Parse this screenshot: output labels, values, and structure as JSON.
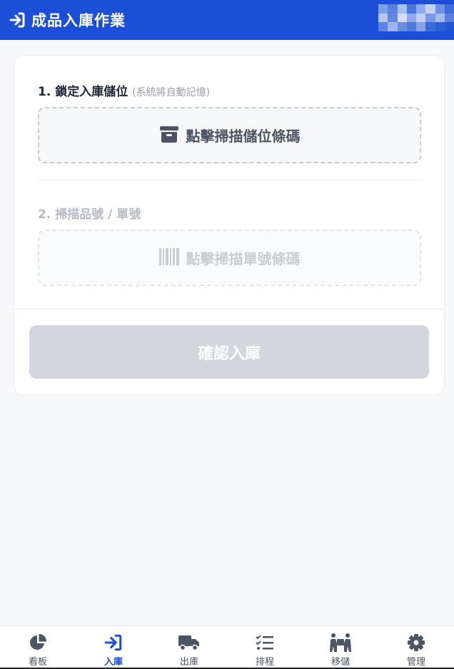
{
  "header": {
    "title": "成品入庫作業",
    "icon": "login-arrow-icon",
    "bg_color": "#1c4ed8"
  },
  "steps": [
    {
      "label": "1. 鎖定入庫儲位",
      "hint": "(系統將自動記憶)",
      "scan_text": "點擊掃描儲位條碼",
      "icon": "box-archive-icon",
      "enabled": true
    },
    {
      "label": "2. 掃描品號 / 單號",
      "scan_text": "點擊掃描單號條碼",
      "icon": "barcode-icon",
      "enabled": false
    }
  ],
  "confirm_label": "確認入庫",
  "tabs": [
    {
      "label": "看板",
      "icon": "chart-pie-icon",
      "active": false
    },
    {
      "label": "入庫",
      "icon": "login-arrow-icon",
      "active": true
    },
    {
      "label": "出庫",
      "icon": "truck-icon",
      "active": false
    },
    {
      "label": "排程",
      "icon": "list-check-icon",
      "active": false
    },
    {
      "label": "移儲",
      "icon": "people-carry-icon",
      "active": false
    },
    {
      "label": "管理",
      "icon": "gear-icon",
      "active": false
    }
  ],
  "colors": {
    "accent": "#1c4ed8",
    "disabled_button": "#d3d6dd",
    "text_dark": "#1f2937",
    "text_muted": "#9aa0a8"
  }
}
